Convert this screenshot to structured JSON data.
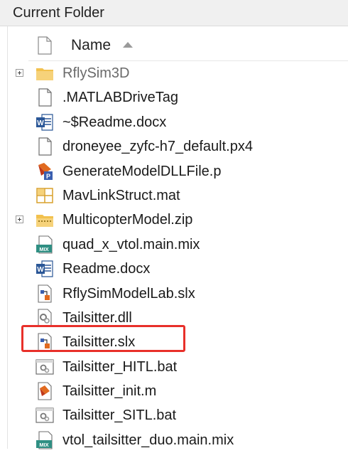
{
  "panel": {
    "title": "Current Folder"
  },
  "header": {
    "name_column": "Name",
    "sort_direction": "ascending"
  },
  "files": [
    {
      "name": "RflySim3D",
      "icon": "folder-icon",
      "expandable": true,
      "dim": true
    },
    {
      "name": ".MATLABDriveTag",
      "icon": "blank-file-icon",
      "expandable": false,
      "dim": false
    },
    {
      "name": "~$Readme.docx",
      "icon": "word-document-icon",
      "expandable": false,
      "dim": false
    },
    {
      "name": "droneyee_zyfc-h7_default.px4",
      "icon": "blank-file-icon",
      "expandable": false,
      "dim": false
    },
    {
      "name": "GenerateModelDLLFile.p",
      "icon": "matlab-p-file-icon",
      "expandable": false,
      "dim": false
    },
    {
      "name": "MavLinkStruct.mat",
      "icon": "mat-file-icon",
      "expandable": false,
      "dim": false
    },
    {
      "name": "MulticopterModel.zip",
      "icon": "zip-folder-icon",
      "expandable": true,
      "dim": false
    },
    {
      "name": "quad_x_vtol.main.mix",
      "icon": "mix-file-icon",
      "expandable": false,
      "dim": false
    },
    {
      "name": "Readme.docx",
      "icon": "word-document-icon",
      "expandable": false,
      "dim": false
    },
    {
      "name": "RflySimModelLab.slx",
      "icon": "simulink-model-icon",
      "expandable": false,
      "dim": false
    },
    {
      "name": "Tailsitter.dll",
      "icon": "dll-file-icon",
      "expandable": false,
      "dim": false
    },
    {
      "name": "Tailsitter.slx",
      "icon": "simulink-model-icon",
      "expandable": false,
      "dim": false,
      "highlighted": true
    },
    {
      "name": "Tailsitter_HITL.bat",
      "icon": "batch-file-icon",
      "expandable": false,
      "dim": false
    },
    {
      "name": "Tailsitter_init.m",
      "icon": "matlab-script-icon",
      "expandable": false,
      "dim": false
    },
    {
      "name": "Tailsitter_SITL.bat",
      "icon": "batch-file-icon",
      "expandable": false,
      "dim": false
    },
    {
      "name": "vtol_tailsitter_duo.main.mix",
      "icon": "mix-file-icon",
      "expandable": false,
      "dim": false
    }
  ],
  "colors": {
    "highlight_border": "#e8302a",
    "folder": "#f2c14e",
    "word_blue": "#2b5797",
    "mix_teal": "#2f8f83",
    "matlab_orange": "#e16a1f"
  }
}
